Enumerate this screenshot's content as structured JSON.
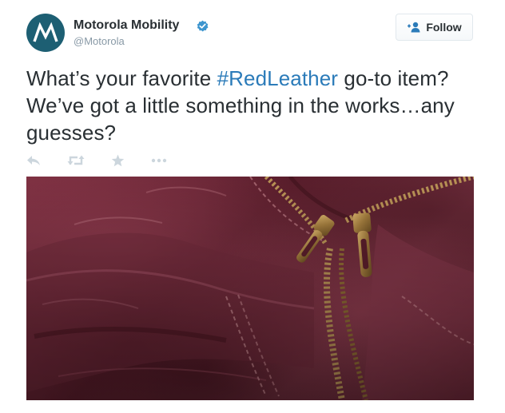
{
  "author": {
    "name": "Motorola Mobility",
    "handle": "@Motorola",
    "verified": true,
    "avatar_icon": "motorola-batwing-logo-icon",
    "avatar_color": "#1d5f73"
  },
  "follow_button": {
    "label": "Follow",
    "icon": "follow-person-plus-icon"
  },
  "tweet": {
    "text_before": "What’s your favorite ",
    "hashtag": "#RedLeather",
    "text_after": " go-to item? We’ve got a little something in the works…any guesses?",
    "hashtag_color": "#2b7bb9"
  },
  "actions": [
    {
      "icon": "reply-icon"
    },
    {
      "icon": "retweet-icon"
    },
    {
      "icon": "favorite-star-icon"
    },
    {
      "icon": "more-dots-icon"
    }
  ],
  "media": {
    "icon": "photo-leather-jacket-zippers"
  }
}
